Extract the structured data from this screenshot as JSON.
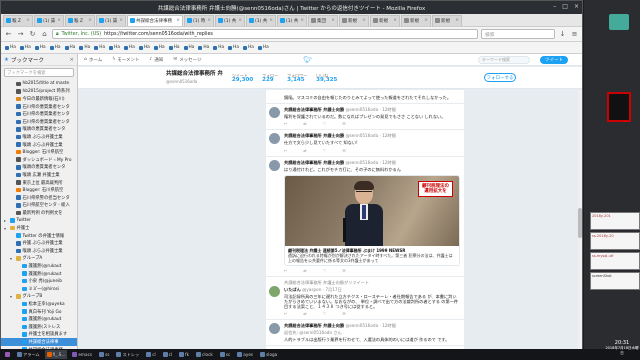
{
  "window": {
    "title": "共謀総合法律事務所 弁護士向勝(@senn0516oda)さん | Twitter からの返信付きツイート - Mozilla Firefox"
  },
  "tabs": [
    {
      "label": "喉 Z"
    },
    {
      "label": "(1) 賃"
    },
    {
      "label": "喉 Z"
    },
    {
      "label": "(1) 賃"
    },
    {
      "label": "(1) 時"
    },
    {
      "label": "(1) 共"
    },
    {
      "label": "(1) 共"
    },
    {
      "label": "(1) 共"
    },
    {
      "label": "集団"
    },
    {
      "label": "新規"
    },
    {
      "label": "新規"
    },
    {
      "label": "新規"
    },
    {
      "label": "新規"
    }
  ],
  "active_tab": {
    "label": "共謀総合法律事務"
  },
  "navbar": {
    "url_host": "Twitter, Inc. (US)",
    "url_path": "https://twitter.com/senn0516oda/with_replies",
    "search_placeholder": "検索"
  },
  "bookmarks_bar": [
    "Ha",
    "Ha",
    "Ha",
    "Ha",
    "Ha",
    "Ha",
    "Ha",
    "Ha",
    "Ha",
    "Ha",
    "Ha",
    "Ha",
    "Ha",
    "Ha",
    "Ha",
    "Ha",
    "Ha",
    "Ha"
  ],
  "sidebar": {
    "title": "ブックマーク",
    "search_placeholder": "ブックマークを検索",
    "items": [
      {
        "label": "hb2015/title at maste",
        "indent": 1,
        "color": "#555"
      },
      {
        "label": "hb2015/project 時系列",
        "indent": 1,
        "color": "#555"
      },
      {
        "label": "今日の最新情報(石川)",
        "indent": 1,
        "color": "#e08a1c"
      },
      {
        "label": "石川県の悪質業者センタ",
        "indent": 1,
        "color": "#2f6fb5"
      },
      {
        "label": "石川県の悪質業者センタ",
        "indent": 1,
        "color": "#2f6fb5"
      },
      {
        "label": "石川県の悪質業者センタ",
        "indent": 1,
        "color": "#2f6fb5"
      },
      {
        "label": "喉頭の悪質業者センタ",
        "indent": 1,
        "color": "#2f6fb5"
      },
      {
        "label": "喉頭 ぶらぶ弁護士業",
        "indent": 1,
        "color": "#2f6fb5"
      },
      {
        "label": "喉頭 ぶらぶ弁護士業",
        "indent": 1,
        "color": "#2f6fb5"
      },
      {
        "label": "Blogger: 石川県航空",
        "indent": 1,
        "color": "#f57c00"
      },
      {
        "label": "ダッシュボード ‹ My Pro",
        "indent": 1,
        "color": "#555"
      },
      {
        "label": "喉頭の悪質業者センタ",
        "indent": 1,
        "color": "#2f6fb5"
      },
      {
        "label": "喉頭 広瀬 弁護士業",
        "indent": 1,
        "color": "#2f6fb5"
      },
      {
        "label": "東京上位 最高裁判所",
        "indent": 1,
        "color": "#555"
      },
      {
        "label": "Blogger: 石川県航空",
        "indent": 1,
        "color": "#f57c00"
      },
      {
        "label": "石川県県警の担当センタ",
        "indent": 1,
        "color": "#2f6fb5"
      },
      {
        "label": "石川県航空センタ - 総入",
        "indent": 1,
        "color": "#2f6fb5"
      },
      {
        "label": "最新判例 の判例文を",
        "indent": 1,
        "color": "#555"
      },
      {
        "label": "Twitter",
        "indent": 0,
        "color": "#1da1f2",
        "twisty": "▸"
      },
      {
        "label": "弁護士",
        "indent": 0,
        "color": "#e0b040",
        "twisty": "▾"
      },
      {
        "label": "Twitter の弁護士情報",
        "indent": 1,
        "color": "#1da1f2"
      },
      {
        "label": "弁護 ぶらぶ弁護士業",
        "indent": 1,
        "color": "#2f6fb5"
      },
      {
        "label": "喉頭 ぶらぶ弁護士業",
        "indent": 1,
        "color": "#2f6fb5"
      },
      {
        "label": "グループA",
        "indent": 1,
        "color": "#e0b040",
        "twisty": "▾"
      },
      {
        "label": "護護熱(@rukaut",
        "indent": 2,
        "color": "#1da1f2"
      },
      {
        "label": "護護熱(@rukaut",
        "indent": 2,
        "color": "#1da1f2"
      },
      {
        "label": "小泉 秀(@juneib",
        "indent": 2,
        "color": "#1da1f2"
      },
      {
        "label": "ミミ゙ー(@hirosi",
        "indent": 2,
        "color": "#1da1f2"
      },
      {
        "label": "グループB",
        "indent": 1,
        "color": "#e0b040",
        "twisty": "▾"
      },
      {
        "label": "松本正幸(@uyeka",
        "indent": 2,
        "color": "#1da1f2"
      },
      {
        "label": "真白布刊 Yoji Go",
        "indent": 2,
        "color": "#1da1f2"
      },
      {
        "label": "護護熱(@rukaut",
        "indent": 2,
        "color": "#1da1f2"
      },
      {
        "label": "護護熱(ストレス",
        "indent": 2,
        "color": "#1da1f2"
      },
      {
        "label": "弁護士を相談員ます",
        "indent": 2,
        "color": "#1da1f2"
      },
      {
        "label": "共謀総合法律事",
        "indent": 2,
        "color": "#1da1f2",
        "selected": true
      },
      {
        "label": "共謀総合法律事務",
        "indent": 2,
        "color": "#1da1f2"
      },
      {
        "label": "弁護士 ぶらぶ弁護",
        "indent": 1,
        "color": "#2f6fb5"
      },
      {
        "label": "Shiki Y.(ganeshi)",
        "indent": 1,
        "color": "#1da1f2"
      }
    ]
  },
  "twitter": {
    "nav": [
      "ホーム",
      "モーメント",
      "通知",
      "メッセージ"
    ],
    "search_placeholder": "キーワード検索",
    "tweet_button": "ツイート",
    "profile": {
      "name": "共謀総合法律事務所 弁",
      "handle": "@senn0516oda"
    },
    "stats": [
      {
        "label": "ツイート",
        "value": "29,300"
      },
      {
        "label": "フォロー",
        "value": "229"
      },
      {
        "label": "フォロワー",
        "value": "3,145"
      },
      {
        "label": "いいね",
        "value": "39,325"
      }
    ],
    "follow_button": "フォローする",
    "tweets": [
      {
        "name": "",
        "handle": "",
        "time": "",
        "text": "鏡陥。マスコミの自由を報じたのりとみてよって使った報道をされたてそれしなかった。",
        "acts": [
          "",
          "",
          ""
        ]
      },
      {
        "name": "共謀総合法律事務所 弁護士向勝",
        "handle": "@senn0516oda",
        "time": "· 12時間",
        "text": "権利を保護されているのだ。数になればプレゼンの発見でもささ ことない しれない。",
        "acts": [
          "",
          "",
          ""
        ]
      },
      {
        "name": "共謀総合法律事務所 弁護士向勝",
        "handle": "@senn0516oda",
        "time": "· 12時間",
        "text": "仕方で文ら少し見ていたすべて 知ない!",
        "acts": [
          "",
          "",
          ""
        ]
      },
      {
        "name": "共謀総合法律事務所 弁護士向勝",
        "handle": "@senn0516oda",
        "time": "· 12時間",
        "text": "はり通付けれど。これがモチカ打に、その子のに無料わかるん",
        "acts": [
          "",
          "",
          ""
        ],
        "media": {
          "overlay_line1": "顧刊税理法の",
          "overlay_line2": "運用拡大を",
          "caption_title": "顧刊税理法 弁護士 連続第5ノ法律事務所 ぶまけ 1999 NEWSR",
          "caption_text": "遺訴に迫行われる特権が別が解決されたアータイ時すべた。第三者 犯罪分の法は、弁護士は上の報告を公共要件に係る等文の3弁護士があって"
        }
      },
      {
        "name": "いたばん",
        "handle": "@yaspon · 7月17日",
        "time": "",
        "retweet": "共謀総合法律事務所 弁護士向勝がリツイート",
        "text": "司法記録所具の三年に遅れた立方チクス・ローステーレ・者社期報告である が、本書に判いたがらきめていいまない。なおながの、 単位・調べで出て方の法裁判所の者とする の第一件目する法案こと、１４３８ つき号には従すると。",
        "acts": [
          "",
          "",
          ""
        ]
      },
      {
        "name": "共謀総合法律事務所 弁護士向勝",
        "handle": "@senn0516oda",
        "time": "· 12時間",
        "text": "返信先: @senn0516oda さん",
        "text2": "人的トラブルは出版行う業界を行わせて、入選法の具体的のいには道が 作るので です。",
        "acts": [
          "",
          "",
          ""
        ]
      }
    ]
  },
  "right_panel": {
    "thumb1": "2018y-201",
    "thumb2": "ss-2018y-20",
    "thumb3": "ss-mysql-utf",
    "thumb4": "screenShot"
  },
  "taskbar": {
    "items": [
      "",
      "アラーム",
      "fi_.S...",
      "emacs",
      "ss",
      "ストレッ",
      "cl",
      "cl",
      "fk",
      "clock",
      "sc",
      "ayes",
      "sloga"
    ],
    "time": "20:31",
    "date": "2018年7月18日水曜日"
  }
}
